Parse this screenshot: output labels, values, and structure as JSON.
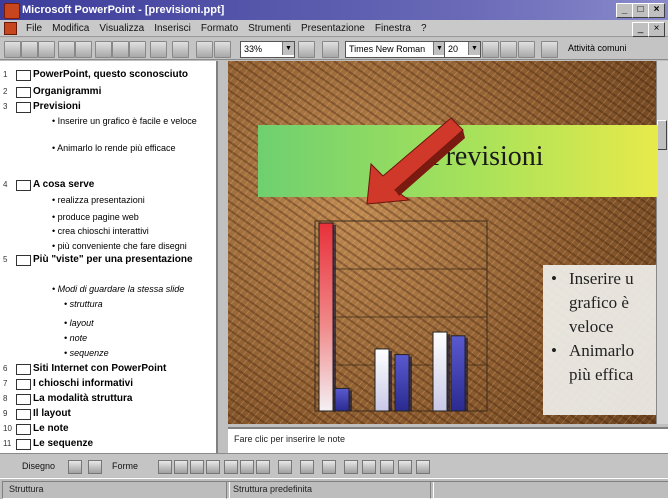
{
  "window": {
    "title": "Microsoft PowerPoint - [previsioni.ppt]"
  },
  "menubar": {
    "items": [
      "File",
      "Modifica",
      "Visualizza",
      "Inserisci",
      "Formato",
      "Strumenti",
      "Presentazione",
      "Finestra",
      "?"
    ]
  },
  "toolbar": {
    "zoom": "33%",
    "font": "Times New Roman",
    "font_size": "20",
    "common_tasks": "Attività comuni"
  },
  "outline": {
    "slides": [
      {
        "num": "1",
        "title": "PowerPoint, questo sconosciuto",
        "bullets": []
      },
      {
        "num": "2",
        "title": "Organigrammi",
        "bullets": []
      },
      {
        "num": "3",
        "title": "Previsioni",
        "bullets": [
          "Inserire un grafico è facile e veloce",
          "Animarlo lo rende più efficace"
        ]
      },
      {
        "num": "4",
        "title": "A cosa serve",
        "bullets": [
          "realizza presentazioni",
          "produce pagine web",
          "crea chioschi interattivi",
          "più conveniente che fare disegni"
        ]
      },
      {
        "num": "5",
        "title": "Più \"viste\" per una presentazione",
        "bullets": [
          "Modi di guardare la stessa slide",
          "struttura",
          "layout",
          "note",
          "sequenze"
        ]
      },
      {
        "num": "6",
        "title": "Siti Internet con PowerPoint",
        "bullets": []
      },
      {
        "num": "7",
        "title": "I chioschi informativi",
        "bullets": []
      },
      {
        "num": "8",
        "title": "La modalità struttura",
        "bullets": []
      },
      {
        "num": "9",
        "title": "Il layout",
        "bullets": []
      },
      {
        "num": "10",
        "title": "Le note",
        "bullets": []
      },
      {
        "num": "11",
        "title": "Le sequenze",
        "bullets": []
      }
    ]
  },
  "slide": {
    "title": "Previsioni",
    "bullets": [
      "Inserire un grafico è facile e veloce",
      "Animarlo lo rende più efficace"
    ],
    "bullet_lines": [
      "Inserire u",
      "grafico è",
      "veloce",
      "Animarlo",
      "più effica"
    ],
    "chart_data": {
      "type": "bar",
      "series": [
        {
          "name": "",
          "values": [
            100,
            12
          ]
        },
        {
          "name": "",
          "values": [
            33,
            30
          ]
        },
        {
          "name": "",
          "values": [
            42,
            40
          ]
        }
      ],
      "colors": {
        "red": "#e8303a",
        "light": "#e6e6f6",
        "blue": "#4848b8"
      }
    }
  },
  "notes": {
    "placeholder": "Fare clic per inserire le note"
  },
  "drawbar": {
    "draw_label": "Disegno",
    "shapes_label": "Forme"
  },
  "statusbar": {
    "left": "Struttura",
    "right": "Struttura predefinita"
  },
  "colors": {
    "title_bar": "#3c3c9a",
    "banner_green": "#6fd070",
    "banner_yellow": "#e8ea4a",
    "arrow": "#d0392a"
  }
}
